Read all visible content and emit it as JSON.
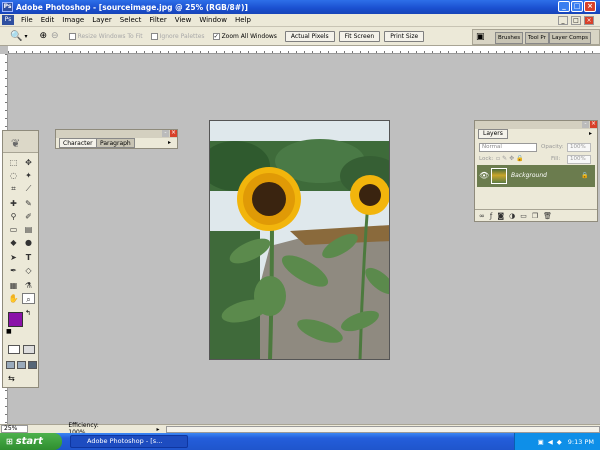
{
  "window": {
    "title": "Adobe Photoshop - [sourceimage.jpg @ 25% (RGB/8#)]"
  },
  "menu": [
    "File",
    "Edit",
    "Image",
    "Layer",
    "Select",
    "Filter",
    "View",
    "Window",
    "Help"
  ],
  "options": {
    "resize_windows": "Resize Windows To Fit",
    "ignore_palettes": "Ignore Palettes",
    "zoom_all": "Zoom All Windows",
    "actual_pixels": "Actual Pixels",
    "fit_screen": "Fit Screen",
    "print_size": "Print Size"
  },
  "palette_well": [
    "Brushes",
    "Tool Pr",
    "Layer Comps"
  ],
  "character_palette": {
    "tabs": [
      "Character",
      "Paragraph"
    ]
  },
  "layers_palette": {
    "title": "Layers",
    "blend_mode": "Normal",
    "opacity_label": "Opacity:",
    "opacity": "100%",
    "lock_label": "Lock:",
    "fill_label": "Fill:",
    "fill": "100%",
    "layer_name": "Background"
  },
  "status": {
    "zoom": "25%",
    "info": "Efficiency: 100%"
  },
  "taskbar": {
    "start": "start",
    "task": "Adobe Photoshop - [s...",
    "time": "9:13 PM"
  },
  "colors": {
    "foreground": "#8a12a8",
    "background": "#ffffff",
    "accent": "#245edb"
  }
}
